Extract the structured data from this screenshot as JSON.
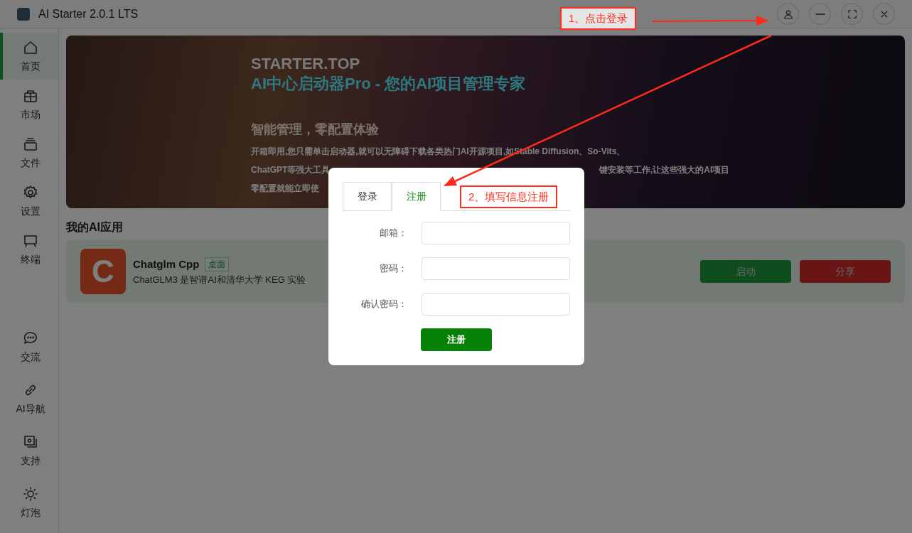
{
  "window": {
    "title": "AI Starter 2.0.1 LTS",
    "controls": [
      {
        "kind": "user"
      },
      {
        "kind": "minimize"
      },
      {
        "kind": "maximize"
      },
      {
        "kind": "close"
      }
    ]
  },
  "sidebar": {
    "items": [
      {
        "kind": "home",
        "label": "首页",
        "selected": true
      },
      {
        "kind": "market",
        "label": "市场",
        "selected": false
      },
      {
        "kind": "files",
        "label": "文件",
        "selected": false
      },
      {
        "kind": "settings",
        "label": "设置",
        "selected": false
      },
      {
        "kind": "terminal",
        "label": "终端",
        "selected": false
      }
    ],
    "bottom_items": [
      {
        "kind": "chat",
        "label": "交流",
        "selected": false
      },
      {
        "kind": "link",
        "label": "AI导航",
        "selected": false
      },
      {
        "kind": "support",
        "label": "支持",
        "selected": false
      },
      {
        "kind": "bulb",
        "label": "灯泡",
        "selected": false
      }
    ]
  },
  "banner": {
    "site": "STARTER.TOP",
    "headline": "AI中心启动器Pro - 您的AI项目管理专家",
    "tagline": "智能管理，零配置体验",
    "lines": [
      {
        "left": "开箱即用,您只需单击启动器,就可以无障碍下载各类热门AI开源项目,如Stable Diffusion、So-Vits、"
      },
      {
        "left": "ChatGPT等强大工具",
        "right": "键安装等工作,让这些强大的AI项目"
      },
      {
        "left": "零配置就能立即使"
      }
    ]
  },
  "section_title": "我的AI应用",
  "apps": [
    {
      "icon_letter": "C",
      "name": "Chatglm Cpp",
      "tag": "桌面",
      "description": "ChatGLM3 是智谱AI和清华大学 KEG 实验",
      "buttons": [
        {
          "kind": "start",
          "label": "启动"
        },
        {
          "kind": "share",
          "label": "分享"
        }
      ]
    }
  ],
  "dialog": {
    "tabs": [
      {
        "label": "登录",
        "selected": false
      },
      {
        "label": "注册",
        "selected": true
      }
    ],
    "fields": [
      {
        "label": "邮箱："
      },
      {
        "label": "密码："
      },
      {
        "label": "确认密码："
      }
    ],
    "submit": "注册"
  },
  "annotations": [
    {
      "text": "1、点击登录"
    },
    {
      "text": "2、填写信息注册"
    }
  ]
}
